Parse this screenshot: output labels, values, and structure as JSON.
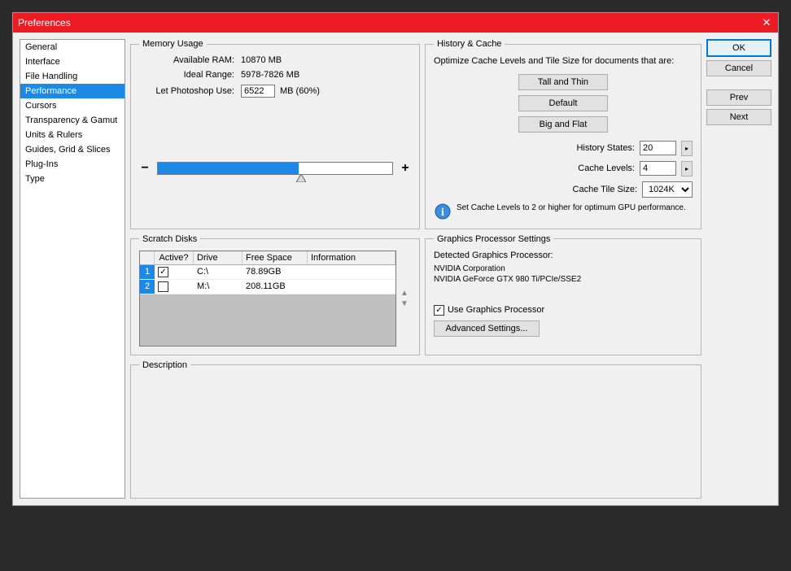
{
  "title": "Preferences",
  "sidebar": {
    "items": [
      {
        "label": "General"
      },
      {
        "label": "Interface"
      },
      {
        "label": "File Handling"
      },
      {
        "label": "Performance"
      },
      {
        "label": "Cursors"
      },
      {
        "label": "Transparency & Gamut"
      },
      {
        "label": "Units & Rulers"
      },
      {
        "label": "Guides, Grid & Slices"
      },
      {
        "label": "Plug-Ins"
      },
      {
        "label": "Type"
      }
    ],
    "selected": 3
  },
  "actions": {
    "ok": "OK",
    "cancel": "Cancel",
    "prev": "Prev",
    "next": "Next"
  },
  "memory": {
    "legend": "Memory Usage",
    "available_label": "Available RAM:",
    "available_value": "10870 MB",
    "ideal_label": "Ideal Range:",
    "ideal_value": "5978-7826 MB",
    "use_label": "Let Photoshop Use:",
    "use_value": "6522",
    "use_suffix": "MB (60%)",
    "minus": "−",
    "plus": "+"
  },
  "history": {
    "legend": "History & Cache",
    "intro": "Optimize Cache Levels and Tile Size for documents that are:",
    "btn_tall": "Tall and Thin",
    "btn_default": "Default",
    "btn_big": "Big and Flat",
    "states_label": "History States:",
    "states_value": "20",
    "levels_label": "Cache Levels:",
    "levels_value": "4",
    "tile_label": "Cache Tile Size:",
    "tile_value": "1024K",
    "note": "Set Cache Levels to 2 or higher for optimum GPU performance."
  },
  "scratch": {
    "legend": "Scratch Disks",
    "headers": {
      "active": "Active?",
      "drive": "Drive",
      "free": "Free Space",
      "info": "Information"
    },
    "rows": [
      {
        "num": "1",
        "active": true,
        "drive": "C:\\",
        "free": "78.89GB",
        "info": ""
      },
      {
        "num": "2",
        "active": false,
        "drive": "M:\\",
        "free": "208.11GB",
        "info": ""
      }
    ]
  },
  "gpu": {
    "legend": "Graphics Processor Settings",
    "detected_label": "Detected Graphics Processor:",
    "vendor": "NVIDIA Corporation",
    "device": "NVIDIA GeForce GTX 980 Ti/PCIe/SSE2",
    "checkbox_label": "Use Graphics Processor",
    "advanced": "Advanced Settings..."
  },
  "description": {
    "legend": "Description"
  }
}
